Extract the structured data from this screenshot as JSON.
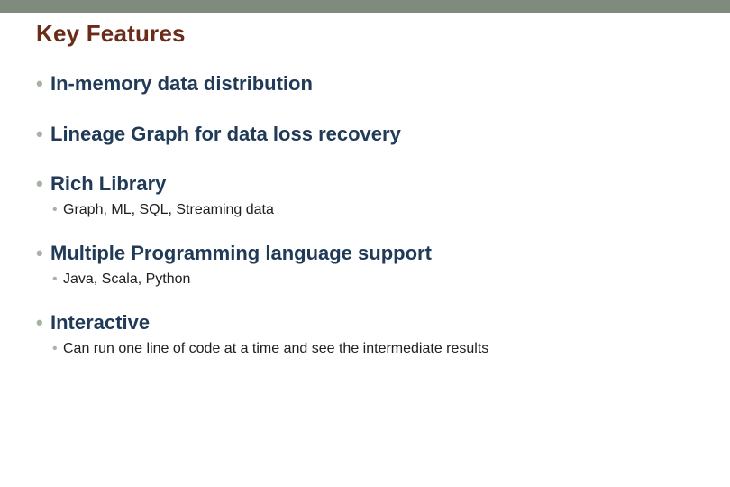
{
  "title": "Key Features",
  "items": [
    {
      "text": "In-memory data distribution"
    },
    {
      "text": "Lineage Graph for data loss recovery"
    },
    {
      "text": "Rich Library",
      "sub": [
        "Graph, ML, SQL, Streaming data"
      ]
    },
    {
      "text": "Multiple Programming language support",
      "sub": [
        "Java, Scala, Python"
      ]
    },
    {
      "text": "Interactive",
      "sub": [
        "Can run one line of code at a time and see the intermediate results"
      ]
    }
  ],
  "colors": {
    "accent_bar": "#7f8b7c",
    "title": "#6a2c18",
    "bullet_main": "#203a57",
    "bullet_marker": "#a6b3a3",
    "subtext": "#202020"
  }
}
